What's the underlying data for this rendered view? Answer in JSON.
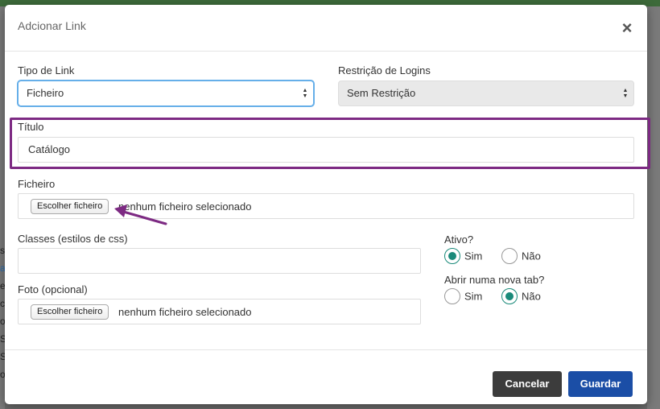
{
  "modal": {
    "title": "Adcionar Link",
    "close_symbol": "×"
  },
  "form": {
    "link_type": {
      "label": "Tipo de Link",
      "value": "Ficheiro"
    },
    "login_restriction": {
      "label": "Restrição de Logins",
      "value": "Sem Restrição"
    },
    "title": {
      "label": "Título",
      "value": "Catálogo"
    },
    "file": {
      "label": "Ficheiro",
      "button": "Escolher ficheiro",
      "status": "nenhum ficheiro selecionado"
    },
    "css_classes": {
      "label": "Classes (estilos de css)",
      "value": ""
    },
    "photo": {
      "label": "Foto (opcional)",
      "button": "Escolher ficheiro",
      "status": "nenhum ficheiro selecionado"
    },
    "active": {
      "label": "Ativo?",
      "yes": "Sim",
      "no": "Não",
      "selected": "Sim"
    },
    "new_tab": {
      "label": "Abrir numa nova tab?",
      "yes": "Sim",
      "no": "Não",
      "selected": "Não"
    }
  },
  "footer": {
    "cancel": "Cancelar",
    "save": "Guardar"
  },
  "colors": {
    "highlight": "#7d2a83",
    "radio_selected": "#1a8a7a",
    "save_button": "#1b4ea6",
    "cancel_button": "#3c3c3c",
    "focus": "#66afe9"
  },
  "icons": {
    "close": "close-icon",
    "select_arrows": "select-arrows-icon",
    "annotation_arrow": "annotation-arrow-icon"
  },
  "background_fragments": [
    "s",
    "a",
    "e",
    "ct",
    "o",
    "S",
    "S",
    "o"
  ]
}
